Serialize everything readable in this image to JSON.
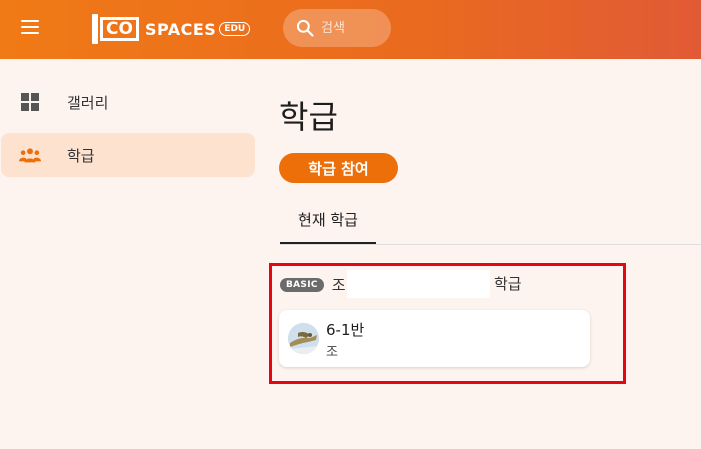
{
  "header": {
    "logo_co": "CO",
    "logo_spaces": "SPACES",
    "logo_edu": "EDU",
    "search_placeholder": "검색"
  },
  "sidebar": {
    "items": [
      {
        "label": "갤러리",
        "icon": "grid-icon",
        "active": false
      },
      {
        "label": "학급",
        "icon": "people-icon",
        "active": true
      }
    ]
  },
  "main": {
    "title": "학급",
    "join_button": "학급 참여",
    "tabs": [
      {
        "label": "현재 학급",
        "active": true
      }
    ],
    "group": {
      "badge": "BASIC",
      "school_prefix": "조",
      "school_suffix": "학급",
      "classes": [
        {
          "name": "6-1반",
          "teacher": "조"
        }
      ]
    }
  },
  "colors": {
    "accent": "#ec6f0a",
    "header_start": "#f07a16",
    "header_end": "#e15a36",
    "active_bg": "#fde2d0",
    "highlight": "#e30613"
  }
}
